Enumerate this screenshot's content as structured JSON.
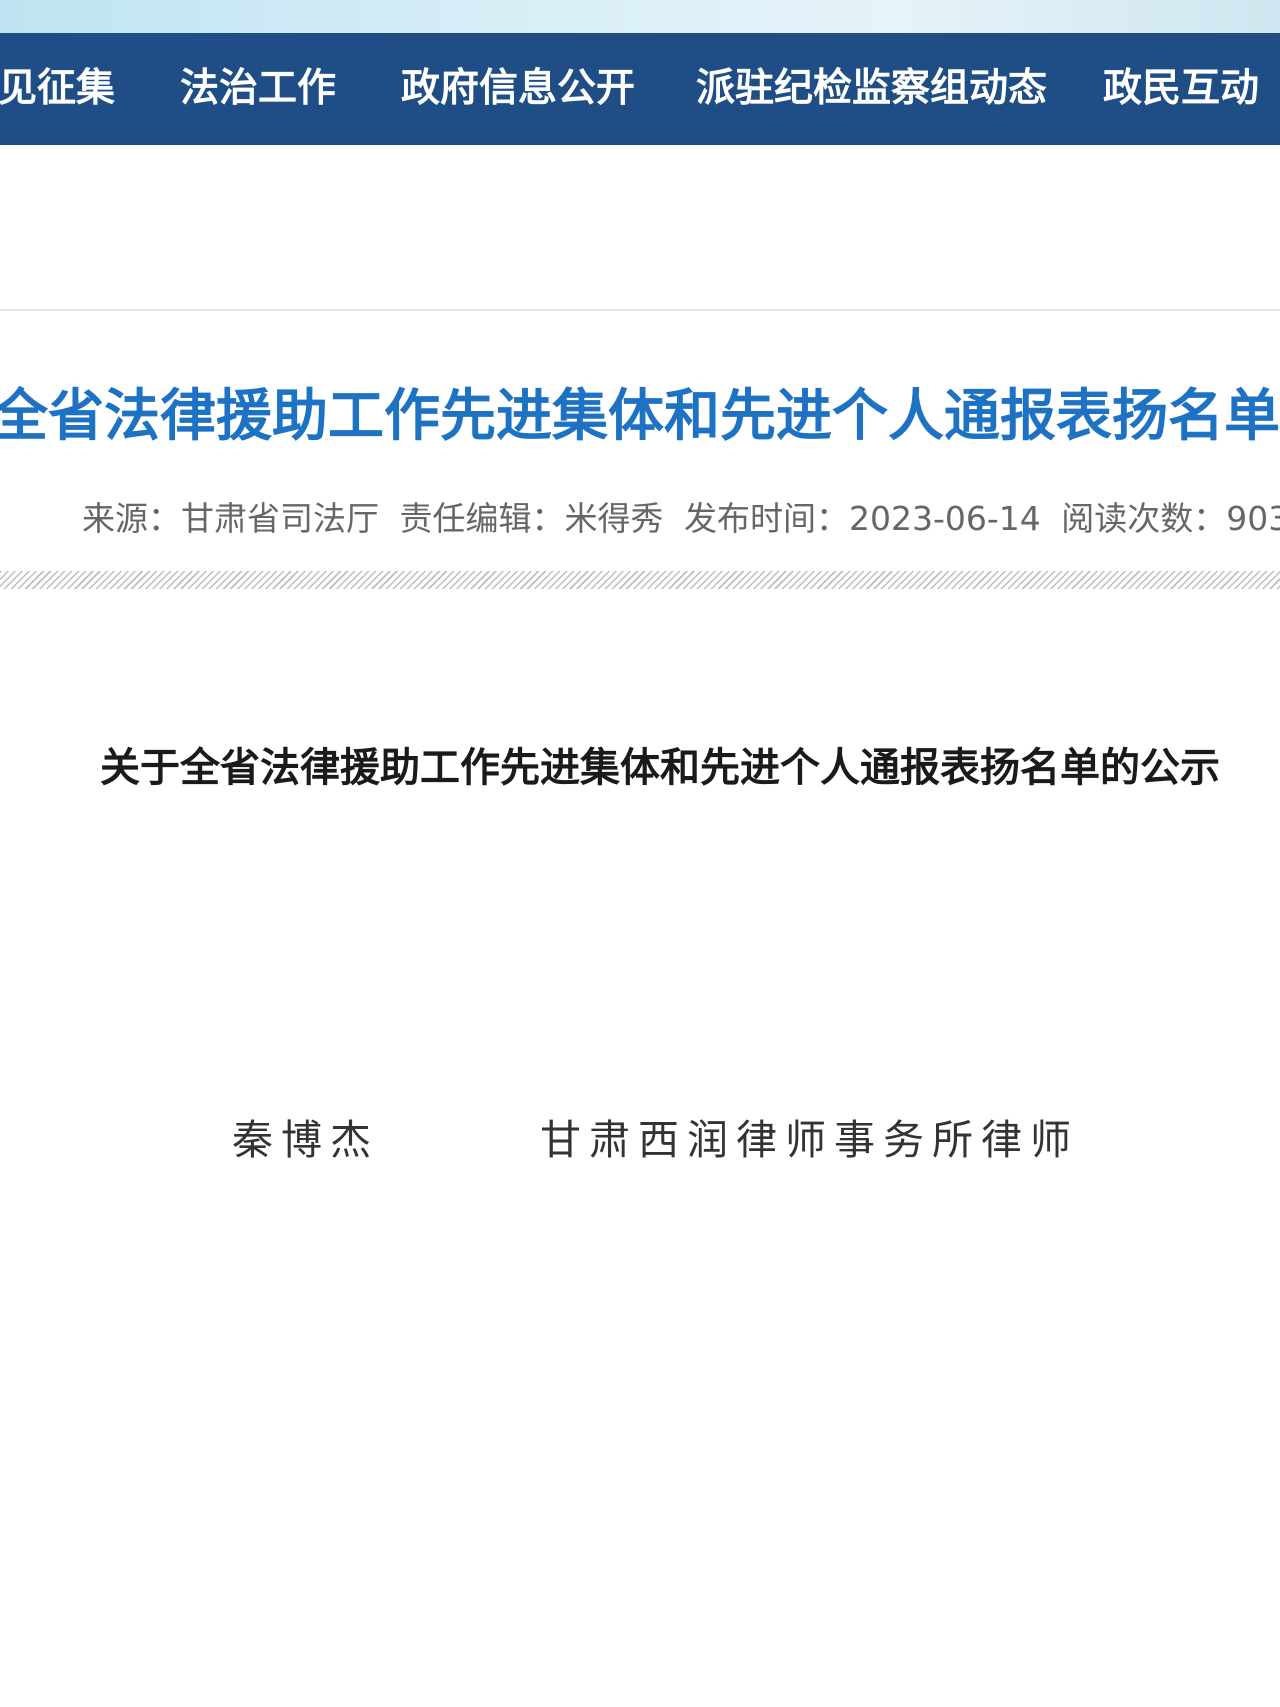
{
  "nav": {
    "items": [
      {
        "label": "见征集"
      },
      {
        "label": "法治工作"
      },
      {
        "label": "政府信息公开"
      },
      {
        "label": "派驻纪检监察组动态"
      },
      {
        "label": "政民互动"
      }
    ]
  },
  "article": {
    "title": "全省法律援助工作先进集体和先进个人通报表扬名单",
    "meta": {
      "source": "来源：甘肃省司法厅",
      "editor": "责任编辑：米得秀",
      "published": "发布时间：2023-06-14",
      "views": "阅读次数：903"
    }
  },
  "document": {
    "title": "关于全省法律援助工作先进集体和先进个人通报表扬名单的公示",
    "entries": [
      {
        "name": "秦博杰",
        "organization": "甘肃西润律师事务所律师"
      }
    ]
  },
  "colors": {
    "nav_background": "#1f4e86",
    "title_blue": "#1e72c4"
  }
}
